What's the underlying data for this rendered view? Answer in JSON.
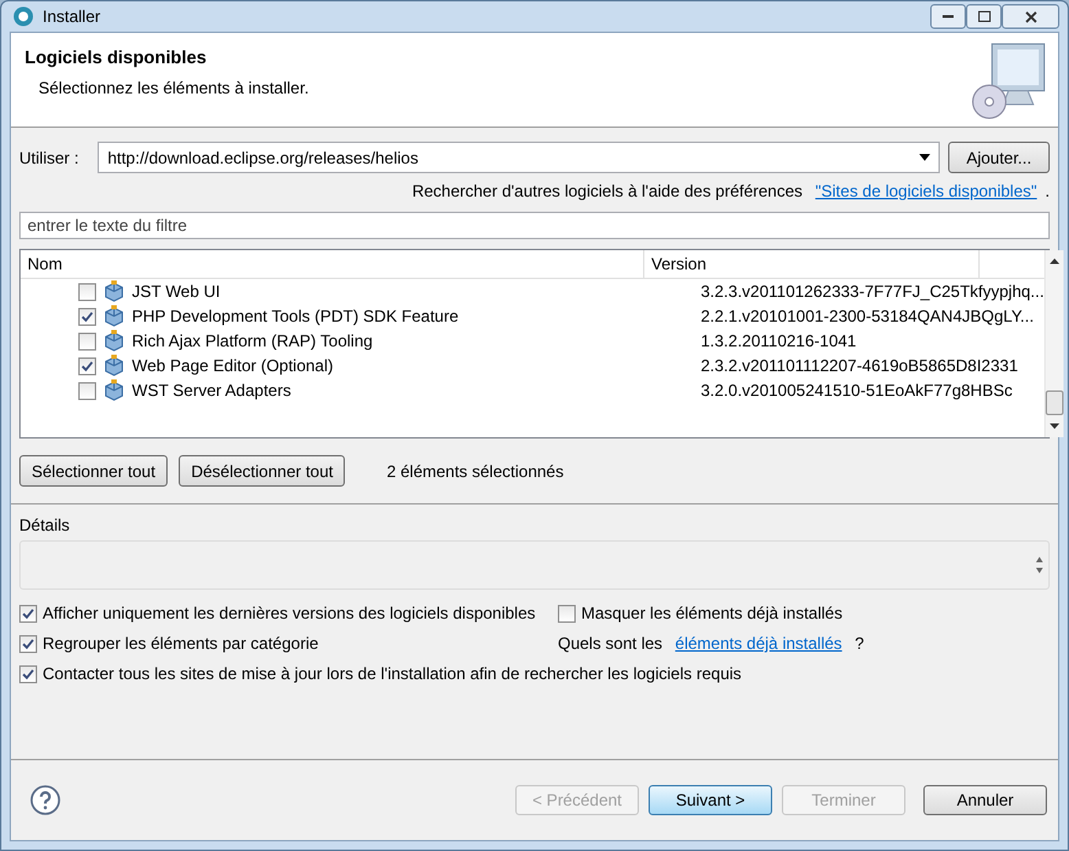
{
  "window": {
    "title": "Installer"
  },
  "header": {
    "title": "Logiciels disponibles",
    "subtitle": "Sélectionnez les éléments à installer."
  },
  "site": {
    "label": "Utiliser :",
    "value": "http://download.eclipse.org/releases/helios",
    "add_button": "Ajouter..."
  },
  "preferences_hint": {
    "text": "Rechercher d'autres logiciels à l'aide des préférences",
    "link": "\"Sites de logiciels disponibles\"",
    "suffix": "."
  },
  "filter": {
    "placeholder": "entrer le texte du filtre"
  },
  "table": {
    "columns": [
      "Nom",
      "Version"
    ],
    "rows": [
      {
        "name": "JST Web UI",
        "version": "3.2.3.v201101262333-7F77FJ_C25Tkfyypjhq...",
        "checked": false
      },
      {
        "name": "PHP Development Tools (PDT) SDK Feature",
        "version": "2.2.1.v20101001-2300-53184QAN4JBQgLY...",
        "checked": true
      },
      {
        "name": "Rich Ajax Platform (RAP) Tooling",
        "version": "1.3.2.20110216-1041",
        "checked": false
      },
      {
        "name": "Web Page Editor (Optional)",
        "version": "2.3.2.v201101112207-4619oB5865D8I2331",
        "checked": true
      },
      {
        "name": "WST Server Adapters",
        "version": "3.2.0.v201005241510-51EoAkF77g8HBSc",
        "checked": false
      }
    ]
  },
  "selection_buttons": [
    "Sélectionner tout",
    "Désélectionner tout"
  ],
  "selection_count": "2 éléments sélectionnés",
  "details": {
    "label": "Détails"
  },
  "options": [
    {
      "label": "Afficher uniquement les dernières versions des logiciels disponibles",
      "checked": true
    },
    {
      "label": "Masquer les éléments déjà installés",
      "checked": false
    },
    {
      "label": "Regrouper les éléments par catégorie",
      "checked": true
    },
    {
      "label": "Contacter tous les sites de mise à jour lors de l'installation afin de rechercher les logiciels requis",
      "checked": true
    }
  ],
  "installed_hint": {
    "text": "Quels sont les",
    "link": "éléments déjà installés",
    "suffix": "?"
  },
  "footer_buttons": [
    {
      "label": "< Précédent",
      "disabled": true,
      "default": false
    },
    {
      "label": "Suivant >",
      "disabled": false,
      "default": true
    },
    {
      "label": "Terminer",
      "disabled": true,
      "default": false
    },
    {
      "label": "Annuler",
      "disabled": false,
      "default": false
    }
  ]
}
